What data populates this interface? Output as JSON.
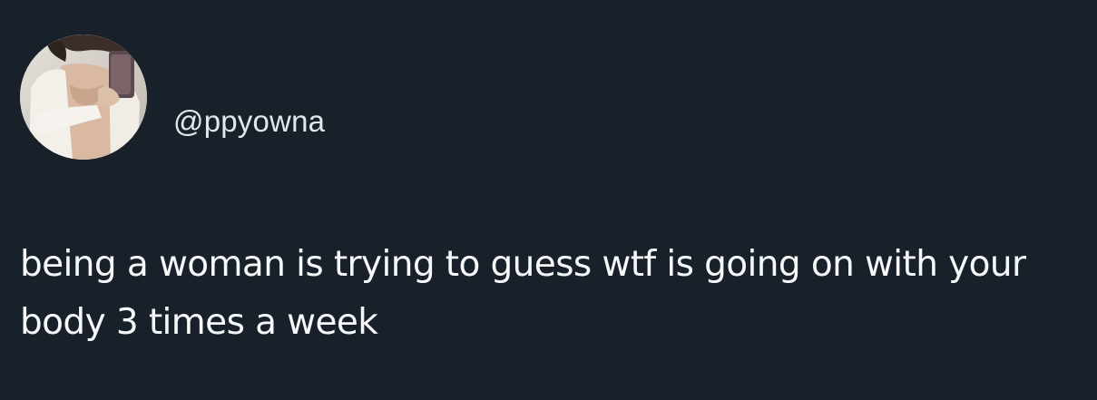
{
  "post": {
    "author": {
      "handle": "@ppyowna",
      "avatar_icon": "profile-photo"
    },
    "text": "being a woman is trying to guess wtf is going on with your body 3 times a week"
  },
  "colors": {
    "background": "#182029",
    "text": "#f5f7f8",
    "handle": "#e3e7ea"
  }
}
